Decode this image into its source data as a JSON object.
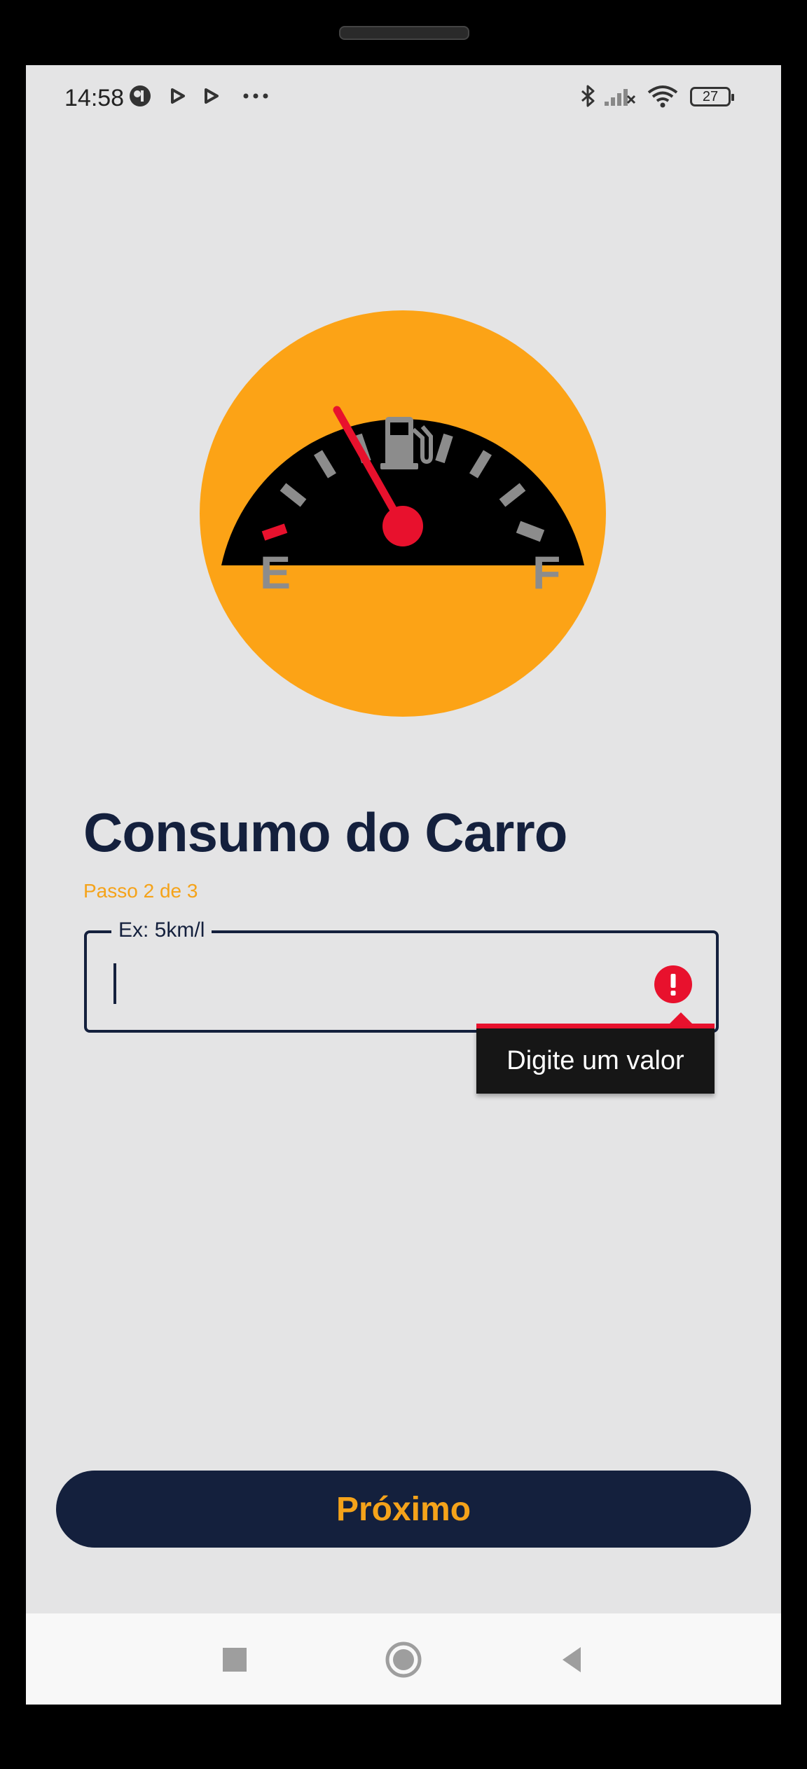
{
  "status_bar": {
    "time": "14:58",
    "battery": "27",
    "icons": [
      "app-icon",
      "play-icon",
      "play-icon",
      "more-dots-icon",
      "bluetooth-icon",
      "signal-icon",
      "wifi-icon",
      "battery-icon"
    ]
  },
  "gauge": {
    "empty_label": "E",
    "full_label": "F",
    "icon": "fuel-pump-icon"
  },
  "page": {
    "title": "Consumo do Carro",
    "step": "Passo 2 de 3"
  },
  "input": {
    "label": "Ex: 5km/l",
    "value": "",
    "error_message": "Digite um valor"
  },
  "actions": {
    "next_label": "Próximo"
  },
  "nav": {
    "icons": [
      "recents-square-icon",
      "home-circle-icon",
      "back-triangle-icon"
    ]
  },
  "colors": {
    "accent": "#f5a31a",
    "primary": "#14203d",
    "error": "#e8112d",
    "background": "#e4e4e5"
  }
}
